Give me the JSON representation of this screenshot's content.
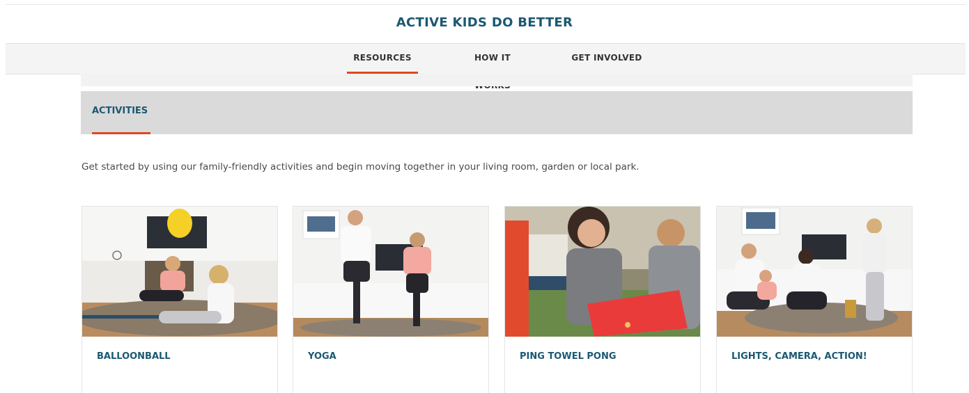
{
  "brand": {
    "title": "ACTIVE KIDS DO BETTER"
  },
  "nav": {
    "items": [
      {
        "label": "RESOURCES",
        "active": true
      },
      {
        "label": "HOW IT WORKS",
        "active": false
      },
      {
        "label": "GET INVOLVED",
        "active": false
      }
    ]
  },
  "section": {
    "tab_label": "ACTIVITIES"
  },
  "intro": {
    "text": "Get started by using our family-friendly activities and begin moving together in your living room, garden or local park."
  },
  "activities": [
    {
      "title": "BALLOONBALL",
      "image": "kids-playing-balloon-photo"
    },
    {
      "title": "YOGA",
      "image": "yoga-pose-photo"
    },
    {
      "title": "PING TOWEL PONG",
      "image": "towel-pong-photo"
    },
    {
      "title": "LIGHTS, CAMERA, ACTION!",
      "image": "family-acting-photo"
    }
  ],
  "colors": {
    "brand": "#1b5872",
    "accent": "#e0471f",
    "nav_bg": "#f4f4f4",
    "section_bg": "#dadada"
  }
}
